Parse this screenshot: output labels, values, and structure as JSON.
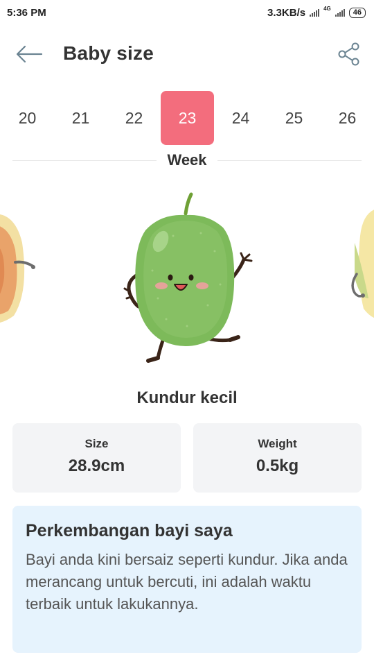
{
  "status": {
    "time": "5:36 PM",
    "speed": "3.3KB/s",
    "network": "4G",
    "battery": "46"
  },
  "header": {
    "title": "Baby size",
    "back_icon": "arrow-left-icon",
    "share_icon": "share-icon"
  },
  "weeks": {
    "items": [
      "20",
      "21",
      "22",
      "23",
      "24",
      "25",
      "26"
    ],
    "selected": "23",
    "label": "Week",
    "accent_color": "#f36d7d"
  },
  "fruit": {
    "name": "Kundur kecil"
  },
  "stats": {
    "size_label": "Size",
    "size_value": "28.9cm",
    "weight_label": "Weight",
    "weight_value": "0.5kg"
  },
  "info": {
    "title": "Perkembangan bayi saya",
    "body": "Bayi anda kini bersaiz seperti kundur. Jika anda merancang untuk bercuti, ini adalah waktu terbaik untuk lakukannya.",
    "background": "#e6f3fd"
  }
}
